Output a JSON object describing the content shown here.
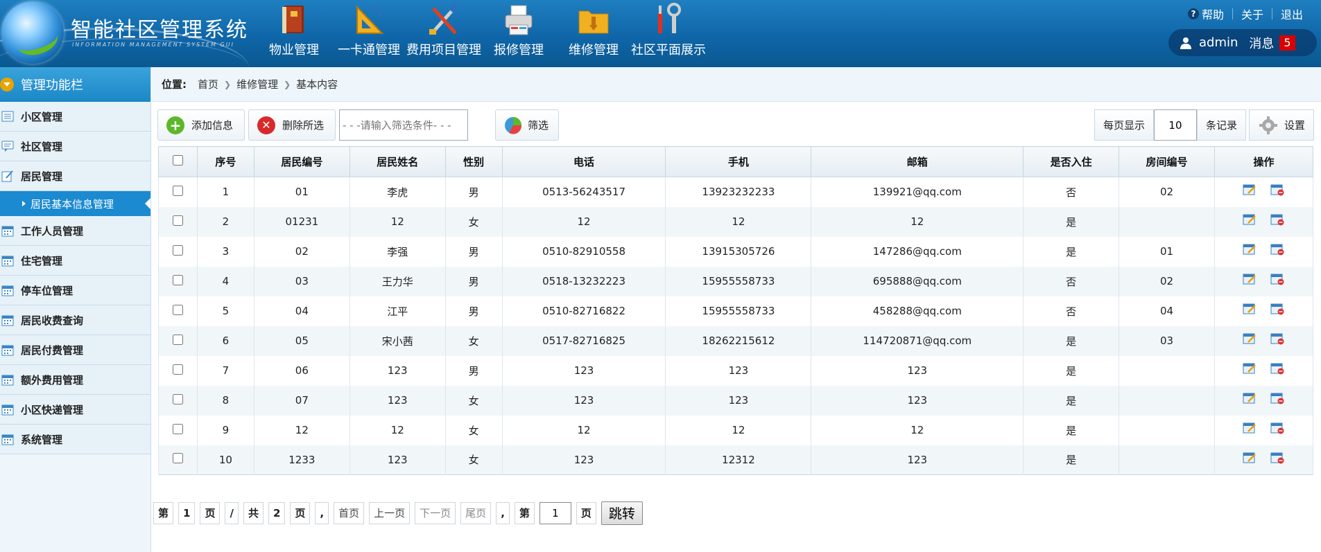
{
  "app": {
    "title": "智能社区管理系统",
    "subtitle": "INFORMATION MANAGEMENT SYSTEM GUI"
  },
  "topnav": [
    {
      "label": "物业管理",
      "icon": "book-icon"
    },
    {
      "label": "一卡通管理",
      "icon": "ruler-icon"
    },
    {
      "label": "费用项目管理",
      "icon": "tools-icon"
    },
    {
      "label": "报修管理",
      "icon": "printer-icon"
    },
    {
      "label": "维修管理",
      "icon": "folder-download-icon"
    },
    {
      "label": "社区平面展示",
      "icon": "wrench-icon"
    }
  ],
  "toplinks": {
    "help": "帮助",
    "about": "关于",
    "logout": "退出"
  },
  "user": {
    "name": "admin",
    "messages_label": "消息",
    "message_count": "5"
  },
  "sidebar": {
    "title": "管理功能栏",
    "items": [
      {
        "label": "小区管理"
      },
      {
        "label": "社区管理"
      },
      {
        "label": "居民管理"
      },
      {
        "label": "居民基本信息管理",
        "sub": true
      },
      {
        "label": "工作人员管理"
      },
      {
        "label": "住宅管理"
      },
      {
        "label": "停车位管理"
      },
      {
        "label": "居民收费查询"
      },
      {
        "label": "居民付费管理"
      },
      {
        "label": "额外费用管理"
      },
      {
        "label": "小区快递管理"
      },
      {
        "label": "系统管理"
      }
    ]
  },
  "breadcrumb": {
    "prefix": "位置:",
    "items": [
      "首页",
      "维修管理",
      "基本内容"
    ]
  },
  "toolbar": {
    "add_label": "添加信息",
    "delete_label": "删除所选",
    "filter_placeholder": "- - -请输入筛选条件- - -",
    "filter_label": "筛选",
    "per_page_label": "每页显示",
    "per_page_value": "10",
    "records_label": "条记录",
    "settings_label": "设置"
  },
  "table": {
    "columns": [
      "序号",
      "居民编号",
      "居民姓名",
      "性别",
      "电话",
      "手机",
      "邮箱",
      "是否入住",
      "房间编号",
      "操作"
    ],
    "rows": [
      [
        "1",
        "01",
        "李虎",
        "男",
        "0513-56243517",
        "13923232233",
        "139921@qq.com",
        "否",
        "02"
      ],
      [
        "2",
        "01231",
        "12",
        "女",
        "12",
        "12",
        "12",
        "是",
        ""
      ],
      [
        "3",
        "02",
        "李强",
        "男",
        "0510-82910558",
        "13915305726",
        "147286@qq.com",
        "是",
        "01"
      ],
      [
        "4",
        "03",
        "王力华",
        "男",
        "0518-13232223",
        "15955558733",
        "695888@qq.com",
        "否",
        "02"
      ],
      [
        "5",
        "04",
        "江平",
        "男",
        "0510-82716822",
        "15955558733",
        "458288@qq.com",
        "否",
        "04"
      ],
      [
        "6",
        "05",
        "宋小茜",
        "女",
        "0517-82716825",
        "18262215612",
        "114720871@qq.com",
        "是",
        "03"
      ],
      [
        "7",
        "06",
        "123",
        "男",
        "123",
        "123",
        "123",
        "是",
        ""
      ],
      [
        "8",
        "07",
        "123",
        "女",
        "123",
        "123",
        "123",
        "是",
        ""
      ],
      [
        "9",
        "12",
        "12",
        "女",
        "12",
        "12",
        "12",
        "是",
        ""
      ],
      [
        "10",
        "1233",
        "123",
        "女",
        "123",
        "12312",
        "123",
        "是",
        ""
      ]
    ]
  },
  "pager": {
    "di": "第",
    "current": "1",
    "ye": "页",
    "slash": "/",
    "gong": "共",
    "total": "2",
    "ye2": "页",
    "comma": ",",
    "first": "首页",
    "prev": "上一页",
    "next": "下一页",
    "last": "尾页",
    "comma2": ",",
    "di2": "第",
    "input_value": "1",
    "ye3": "页",
    "go": "跳转"
  }
}
